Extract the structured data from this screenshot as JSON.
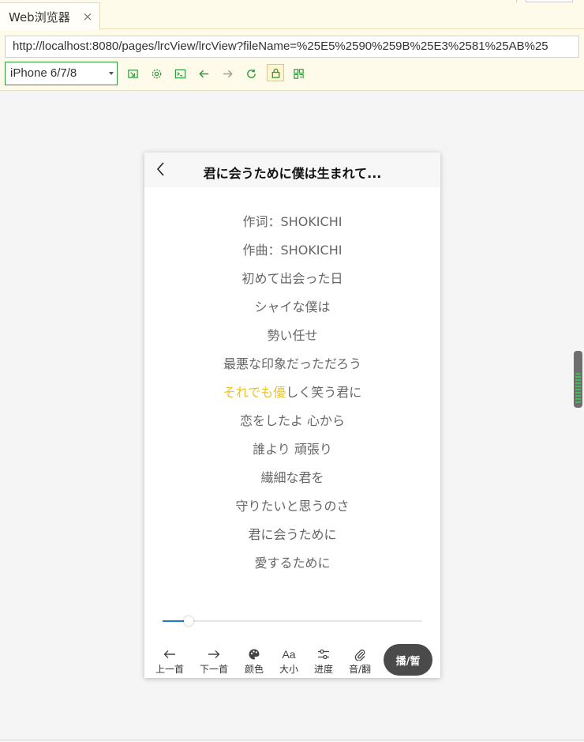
{
  "browser": {
    "tab_title": "Web浏览器",
    "tab_close": "×",
    "url": "http://localhost:8080/pages/lrcView/lrcView?fileName=%25E5%2590%259B%25E3%2581%25AB%25",
    "device": "iPhone 6/7/8"
  },
  "page": {
    "nav_title": "君に会うために僕は生まれて..."
  },
  "lyrics": {
    "lines": [
      "作词：SHOKICHI",
      "作曲：SHOKICHI",
      "初めて出会った日",
      "シャイな僕は",
      "勢い任せ",
      "最悪な印象だっただろう",
      "それでも優しく笑う君に",
      "恋をしたよ 心から",
      "誰より 頑張り",
      "繊細な君を",
      "守りたいと思うのさ",
      "君に会うために",
      "愛するために"
    ],
    "current_line_index": 6,
    "current_highlight": "それでも優",
    "current_rest": "しく笑う君に",
    "highlight_color": "#f0c419"
  },
  "player": {
    "progress_fraction": 0.1,
    "accent_color": "#1f7ac2"
  },
  "controls": {
    "prev": "上一首",
    "next": "下一首",
    "color": "颜色",
    "size_icon": "Aa",
    "size": "大小",
    "progress": "进度",
    "audio": "音/翻",
    "play": "播/暂"
  },
  "icons": {
    "minimize": "minimize-icon",
    "settings": "gear-icon",
    "terminal": "terminal-icon",
    "back": "arrow-left-icon",
    "forward": "arrow-right-icon",
    "reload": "reload-icon",
    "lock": "lock-icon",
    "qr": "qrcode-icon"
  }
}
